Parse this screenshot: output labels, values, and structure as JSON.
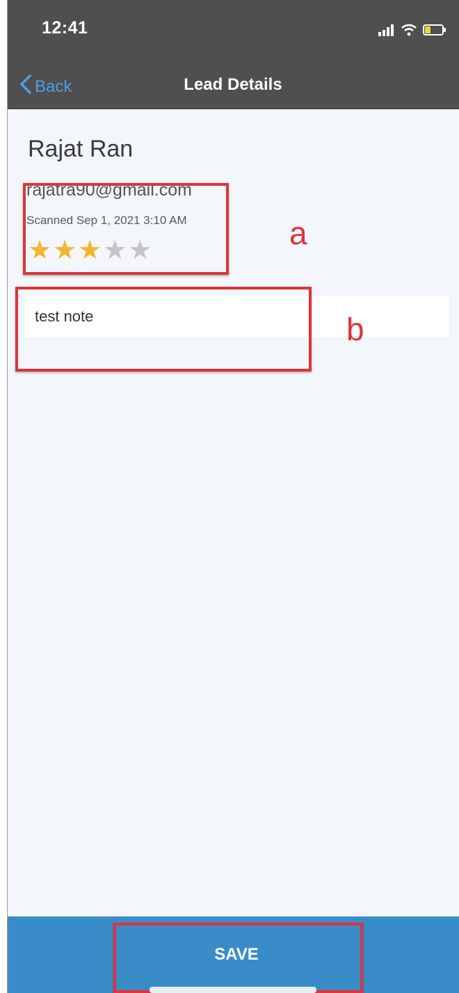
{
  "status_bar": {
    "time": "12:41",
    "icons": [
      "signal-icon",
      "wifi-icon",
      "battery-icon"
    ]
  },
  "nav": {
    "back_label": "Back",
    "title": "Lead Details"
  },
  "lead": {
    "name": "Rajat Ran",
    "email": "rajatra90@gmail.com",
    "scanned": "Scanned Sep 1, 2021 3:10 AM",
    "rating": 3,
    "rating_max": 5
  },
  "note": {
    "value": "test note"
  },
  "annotations": {
    "a": "a",
    "b": "b"
  },
  "footer": {
    "save_label": "SAVE"
  },
  "colors": {
    "accent": "#3a8cc8",
    "star_filled": "#f3b52d",
    "star_empty": "#c4c4c4",
    "annotation": "#e0333a",
    "header": "#4f4f4f",
    "back_link": "#4aa0e6"
  }
}
